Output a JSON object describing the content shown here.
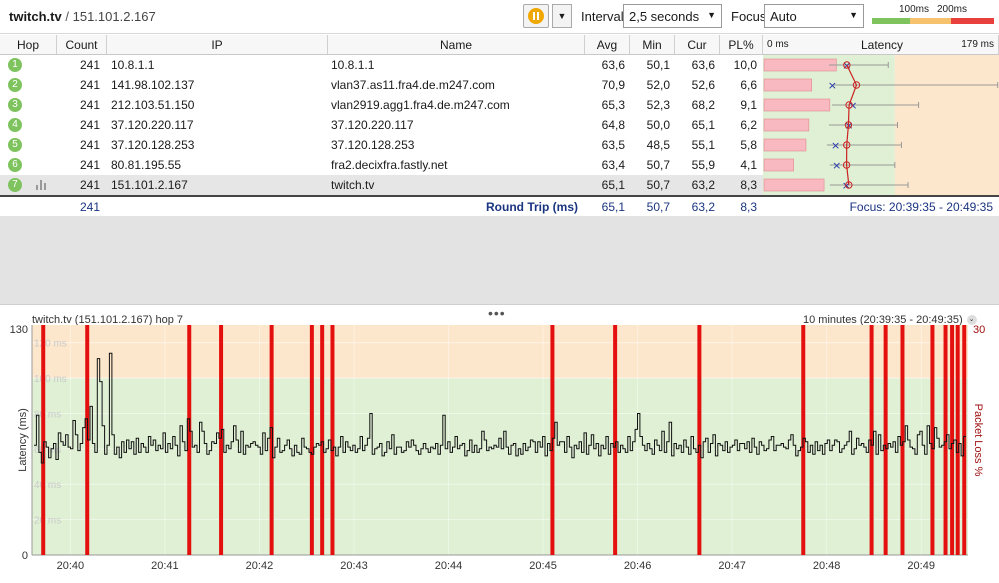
{
  "toolbar": {
    "target_host": "twitch.tv",
    "separator": "/",
    "target_ip": "151.101.2.167",
    "interval_label": "Interval",
    "interval_value": "2,5 seconds",
    "focus_label": "Focus",
    "focus_value": "Auto",
    "legend_100": "100ms",
    "legend_200": "200ms",
    "pause_icon": "pause-icon",
    "dropdown_icon": "chevron-down-icon"
  },
  "table": {
    "headers": {
      "hop": "Hop",
      "count": "Count",
      "ip": "IP",
      "name": "Name",
      "avg": "Avg",
      "min": "Min",
      "cur": "Cur",
      "pl": "PL%",
      "latency_min": "0 ms",
      "latency": "Latency",
      "latency_max": "179 ms"
    },
    "rows": [
      {
        "hop": "1",
        "count": "241",
        "ip": "10.8.1.1",
        "name": "10.8.1.1",
        "avg": "63,6",
        "min": "50,1",
        "cur": "63,6",
        "pl": "10,0",
        "plv": 10.0,
        "avgv": 63.6,
        "minv": 50.1,
        "curv": 63.6,
        "maxv": 95
      },
      {
        "hop": "2",
        "count": "241",
        "ip": "141.98.102.137",
        "name": "vlan37.as11.fra4.de.m247.com",
        "avg": "70,9",
        "min": "52,0",
        "cur": "52,6",
        "pl": "6,6",
        "plv": 6.6,
        "avgv": 70.9,
        "minv": 52.0,
        "curv": 52.6,
        "maxv": 178
      },
      {
        "hop": "3",
        "count": "241",
        "ip": "212.103.51.150",
        "name": "vlan2919.agg1.fra4.de.m247.com",
        "avg": "65,3",
        "min": "52,3",
        "cur": "68,2",
        "pl": "9,1",
        "plv": 9.1,
        "avgv": 65.3,
        "minv": 52.3,
        "curv": 68.2,
        "maxv": 118
      },
      {
        "hop": "4",
        "count": "241",
        "ip": "37.120.220.117",
        "name": "37.120.220.117",
        "avg": "64,8",
        "min": "50,0",
        "cur": "65,1",
        "pl": "6,2",
        "plv": 6.2,
        "avgv": 64.8,
        "minv": 50.0,
        "curv": 65.1,
        "maxv": 102
      },
      {
        "hop": "5",
        "count": "241",
        "ip": "37.120.128.253",
        "name": "37.120.128.253",
        "avg": "63,5",
        "min": "48,5",
        "cur": "55,1",
        "pl": "5,8",
        "plv": 5.8,
        "avgv": 63.5,
        "minv": 48.5,
        "curv": 55.1,
        "maxv": 105
      },
      {
        "hop": "6",
        "count": "241",
        "ip": "80.81.195.55",
        "name": "fra2.decixfra.fastly.net",
        "avg": "63,4",
        "min": "50,7",
        "cur": "55,9",
        "pl": "4,1",
        "plv": 4.1,
        "avgv": 63.4,
        "minv": 50.7,
        "curv": 55.9,
        "maxv": 100
      },
      {
        "hop": "7",
        "count": "241",
        "ip": "151.101.2.167",
        "name": "twitch.tv",
        "avg": "65,1",
        "min": "50,7",
        "cur": "63,2",
        "pl": "8,3",
        "plv": 8.3,
        "avgv": 65.1,
        "minv": 50.7,
        "curv": 63.2,
        "maxv": 110
      }
    ],
    "summary": {
      "count": "241",
      "label": "Round Trip (ms)",
      "avg": "65,1",
      "min": "50,7",
      "cur": "63,2",
      "pl": "8,3",
      "focus": "Focus: 20:39:35 - 20:49:35"
    }
  },
  "chart_header": {
    "title": "twitch.tv (151.101.2.167) hop 7",
    "range": "10 minutes (20:39:35 - 20:49:35)"
  },
  "chart_data": {
    "type": "line",
    "ylabel": "Latency (ms)",
    "y2label": "Packet Loss %",
    "ylim": [
      0,
      130
    ],
    "y_ticks": [
      "0",
      "130"
    ],
    "y2_max": "30",
    "zone_labels": [
      "20 ms",
      "40 ms",
      "60 ms",
      "80 ms",
      "100 ms",
      "120 ms"
    ],
    "zones": [
      {
        "from": 0,
        "to": 100,
        "color": "#dff0d4"
      },
      {
        "from": 100,
        "to": 130,
        "color": "#fde7cc"
      }
    ],
    "x_ticks": [
      "20:40",
      "20:41",
      "20:42",
      "20:43",
      "20:44",
      "20:45",
      "20:46",
      "20:47",
      "20:48",
      "20:49"
    ],
    "x_tick_fractions": [
      0.041,
      0.142,
      0.243,
      0.344,
      0.445,
      0.546,
      0.647,
      0.748,
      0.849,
      0.95
    ],
    "series": [
      {
        "values": [
          62,
          79,
          58,
          52,
          64,
          61,
          55,
          60,
          63,
          54,
          69,
          64,
          62,
          68,
          61,
          60,
          76,
          68,
          59,
          63,
          72,
          77,
          65,
          84,
          63,
          58,
          111,
          98,
          73,
          57,
          62,
          114,
          68,
          57,
          61,
          55,
          64,
          58,
          65,
          60,
          64,
          57,
          66,
          58,
          63,
          61,
          58,
          67,
          62,
          65,
          59,
          62,
          60,
          69,
          58,
          63,
          60,
          67,
          62,
          56,
          73,
          64,
          59,
          77,
          70,
          61,
          62,
          58,
          75,
          70,
          63,
          57,
          59,
          64,
          63,
          69,
          66,
          71,
          58,
          62,
          60,
          64,
          73,
          65,
          58,
          70,
          57,
          62,
          61,
          63,
          64,
          62,
          61,
          57,
          69,
          59,
          66,
          72,
          55,
          61,
          66,
          58,
          59,
          62,
          65,
          60,
          56,
          62,
          58,
          57,
          66,
          61,
          60,
          58,
          57,
          61,
          63,
          62,
          64,
          58,
          60,
          65,
          59,
          61,
          56,
          61,
          67,
          58,
          64,
          61,
          59,
          62,
          58,
          60,
          67,
          59,
          62,
          66,
          80,
          57,
          60,
          61,
          63,
          56,
          58,
          64,
          60,
          68,
          57,
          61,
          61,
          58,
          59,
          64,
          61,
          65,
          62,
          59,
          57,
          60,
          63,
          60,
          58,
          61,
          60,
          63,
          57,
          62,
          79,
          60,
          64,
          58,
          61,
          67,
          60,
          62,
          63,
          56,
          59,
          65,
          58,
          62,
          58,
          60,
          70,
          65,
          59,
          61,
          60,
          62,
          61,
          66,
          60,
          70,
          61,
          57,
          62,
          63,
          56,
          60,
          57,
          63,
          59,
          61,
          65,
          64,
          58,
          64,
          61,
          67,
          56,
          63,
          59,
          66,
          75,
          62,
          64,
          64,
          58,
          67,
          61,
          55,
          62,
          60,
          64,
          58,
          69,
          57,
          62,
          68,
          60,
          63,
          56,
          62,
          60,
          67,
          57,
          63,
          61,
          64,
          58,
          62,
          60,
          58,
          67,
          59,
          64,
          71,
          80,
          67,
          62,
          59,
          63,
          60,
          57,
          65,
          62,
          59,
          70,
          58,
          64,
          75,
          56,
          63,
          60,
          62,
          58,
          65,
          61,
          57,
          67,
          60,
          58,
          62,
          55,
          64,
          66,
          58,
          63,
          68,
          56,
          63,
          62,
          59,
          64,
          58,
          61,
          62,
          65,
          59,
          63,
          63,
          60,
          64,
          58,
          66,
          61,
          57,
          64,
          62,
          59,
          60,
          65,
          67,
          59,
          62,
          62,
          63,
          61,
          60,
          65,
          68,
          62,
          56,
          59,
          61,
          66,
          64,
          58,
          62,
          57,
          64,
          59,
          62,
          57,
          63,
          65,
          59,
          62,
          65,
          64,
          58,
          60,
          62,
          64,
          70,
          57,
          60,
          66,
          62,
          63,
          61,
          58,
          65,
          62,
          70,
          57,
          68,
          59,
          62,
          60,
          63,
          61,
          64,
          58,
          67,
          62,
          64,
          73,
          65,
          61,
          60,
          57,
          68,
          70,
          62,
          57,
          73,
          63,
          60,
          72,
          66,
          61,
          62,
          64,
          68,
          60,
          63,
          65,
          58,
          63,
          56,
          67
        ]
      }
    ],
    "loss_markers": [
      0.012,
      0.059,
      0.168,
      0.202,
      0.256,
      0.299,
      0.31,
      0.321,
      0.556,
      0.623,
      0.713,
      0.824,
      0.897,
      0.912,
      0.93,
      0.962,
      0.976,
      0.983,
      0.989,
      0.996
    ]
  },
  "colors": {
    "green": "#7fc35f",
    "orange": "#f7c26e",
    "red": "#e8403c",
    "loss": "#e41010",
    "line": "#111111",
    "bar_pink": "#f8b9c0"
  }
}
